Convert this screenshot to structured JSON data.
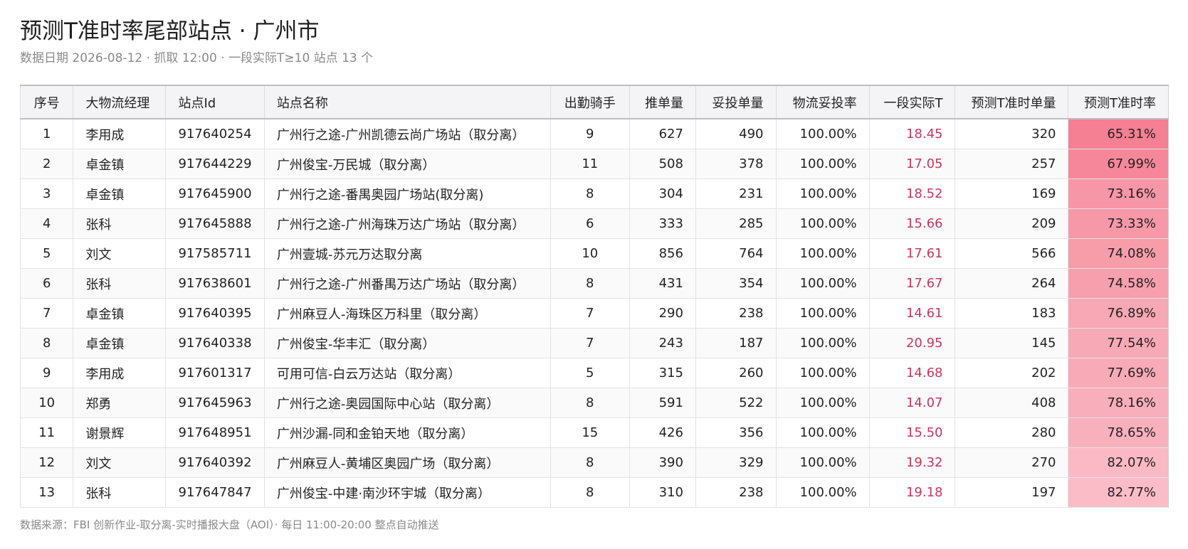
{
  "header": {
    "title": "预测T准时率尾部站点 · 广州市",
    "subtitle": "数据日期 2026-08-12 · 抓取 12:00 · 一段实际T≥10 站点 13 个"
  },
  "table": {
    "columns": [
      "序号",
      "大物流经理",
      "站点Id",
      "站点名称",
      "出勤骑手",
      "推单量",
      "妥投单量",
      "物流妥投率",
      "一段实际T",
      "预测T准时单量",
      "预测T准时率"
    ],
    "rows": [
      [
        "1",
        "李用成",
        "917640254",
        "广州行之途-广州凯德云尚广场站（取分离）",
        "9",
        "627",
        "490",
        "100.00%",
        "18.45",
        "320",
        "65.31%"
      ],
      [
        "2",
        "卓金镇",
        "917644229",
        "广州俊宝-万民城（取分离）",
        "11",
        "508",
        "378",
        "100.00%",
        "17.05",
        "257",
        "67.99%"
      ],
      [
        "3",
        "卓金镇",
        "917645900",
        "广州行之途-番禺奥园广场站(取分离)",
        "8",
        "304",
        "231",
        "100.00%",
        "18.52",
        "169",
        "73.16%"
      ],
      [
        "4",
        "张科",
        "917645888",
        "广州行之途-广州海珠万达广场站（取分离）",
        "6",
        "333",
        "285",
        "100.00%",
        "15.66",
        "209",
        "73.33%"
      ],
      [
        "5",
        "刘文",
        "917585711",
        "广州壹城-苏元万达取分离",
        "10",
        "856",
        "764",
        "100.00%",
        "17.61",
        "566",
        "74.08%"
      ],
      [
        "6",
        "张科",
        "917638601",
        "广州行之途-广州番禺万达广场站（取分离）",
        "8",
        "431",
        "354",
        "100.00%",
        "17.67",
        "264",
        "74.58%"
      ],
      [
        "7",
        "卓金镇",
        "917640395",
        "广州麻豆人-海珠区万科里（取分离）",
        "7",
        "290",
        "238",
        "100.00%",
        "14.61",
        "183",
        "76.89%"
      ],
      [
        "8",
        "卓金镇",
        "917640338",
        "广州俊宝-华丰汇（取分离）",
        "7",
        "243",
        "187",
        "100.00%",
        "20.95",
        "145",
        "77.54%"
      ],
      [
        "9",
        "李用成",
        "917601317",
        "可用可信-白云万达站（取分离）",
        "5",
        "315",
        "260",
        "100.00%",
        "14.68",
        "202",
        "77.69%"
      ],
      [
        "10",
        "郑勇",
        "917645963",
        "广州行之途-奥园国际中心站（取分离）",
        "8",
        "591",
        "522",
        "100.00%",
        "14.07",
        "408",
        "78.16%"
      ],
      [
        "11",
        "谢景辉",
        "917648951",
        "广州沙漏-同和金铂天地（取分离）",
        "15",
        "426",
        "356",
        "100.00%",
        "15.50",
        "280",
        "78.65%"
      ],
      [
        "12",
        "刘文",
        "917640392",
        "广州麻豆人-黄埔区奥园广场（取分离）",
        "8",
        "390",
        "329",
        "100.00%",
        "19.32",
        "270",
        "82.07%"
      ],
      [
        "13",
        "张科",
        "917647847",
        "广州俊宝-中建·南沙环宇城（取分离）",
        "8",
        "310",
        "238",
        "100.00%",
        "19.18",
        "197",
        "82.77%"
      ]
    ],
    "rate_fill_colors": [
      "#f57f93",
      "#f6879a",
      "#f796a7",
      "#f798a8",
      "#f79daa",
      "#f79fad",
      "#f8a7b4",
      "#f8a9b6",
      "#f8aab7",
      "#f9aebb",
      "#f9b0bd",
      "#fab9c4",
      "#fbbcc7"
    ]
  },
  "footer": {
    "text": "数据来源：FBI 创新作业-取分离-实时播报大盘（AOI）· 每日 11:00-20:00 整点自动推送"
  }
}
